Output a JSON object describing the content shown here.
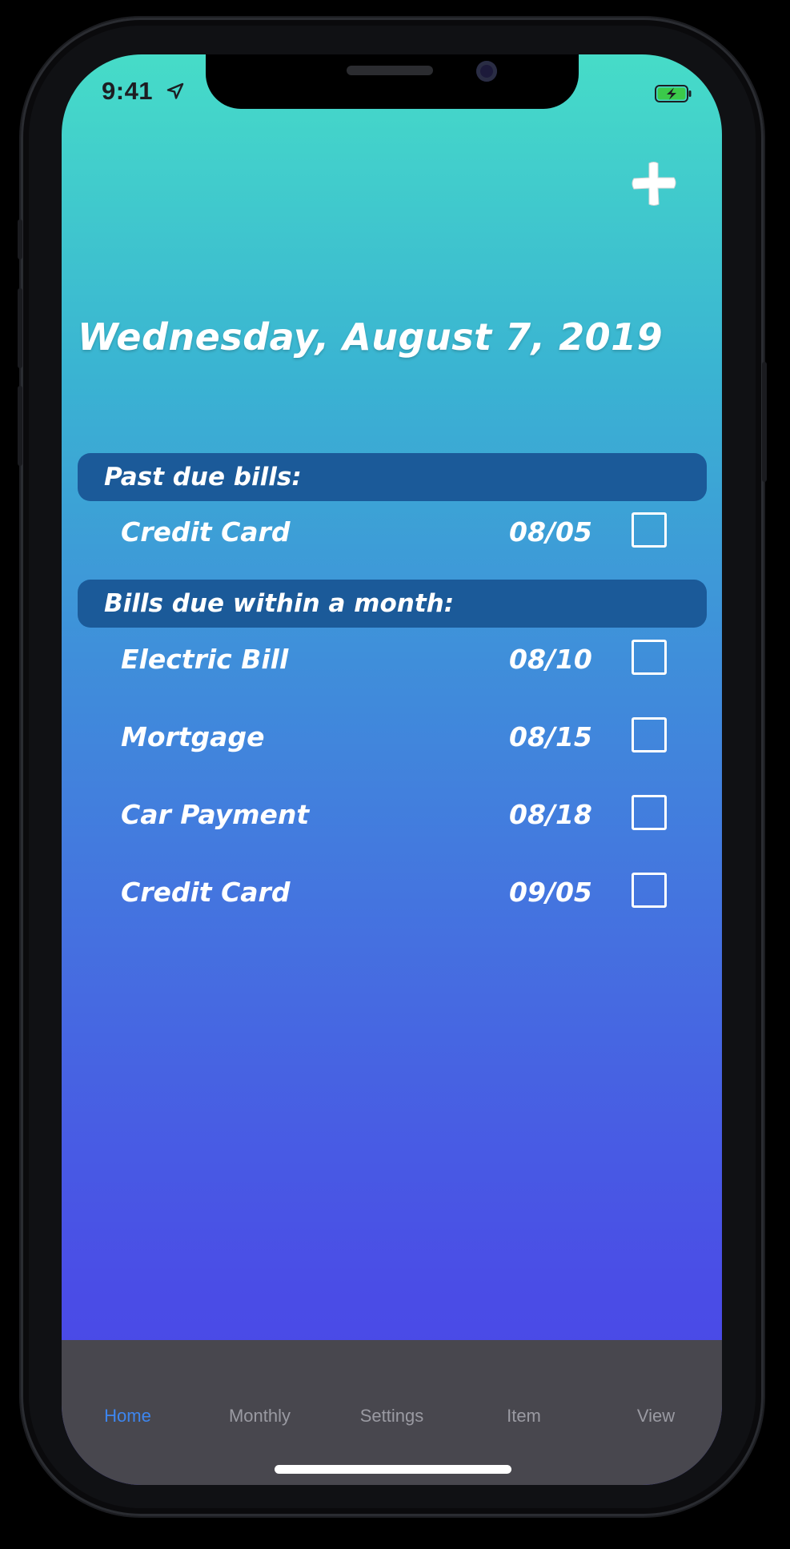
{
  "status_bar": {
    "time": "9:41",
    "location_icon": "location-arrow-icon",
    "battery_icon": "battery-charging-icon"
  },
  "header": {
    "add_icon": "plus-icon",
    "date": "Wednesday, August 7, 2019"
  },
  "sections": [
    {
      "title": "Past due bills:",
      "bills": [
        {
          "name": "Credit Card",
          "due": "08/05",
          "checked": false
        }
      ]
    },
    {
      "title": "Bills due within a month:",
      "bills": [
        {
          "name": "Electric Bill",
          "due": "08/10",
          "checked": false
        },
        {
          "name": "Mortgage",
          "due": "08/15",
          "checked": false
        },
        {
          "name": "Car Payment",
          "due": "08/18",
          "checked": false
        },
        {
          "name": "Credit Card",
          "due": "09/05",
          "checked": false
        }
      ]
    }
  ],
  "tabbar": {
    "tabs": [
      {
        "label": "Home",
        "active": true
      },
      {
        "label": "Monthly",
        "active": false
      },
      {
        "label": "Settings",
        "active": false
      },
      {
        "label": "Item",
        "active": false
      },
      {
        "label": "View",
        "active": false
      }
    ],
    "active_color": "#3d86f0",
    "inactive_color": "#9a9aa2"
  },
  "colors": {
    "section_header": "#1b5a99",
    "gradient_top": "#46dcc8",
    "gradient_bottom": "#4b44ea"
  }
}
